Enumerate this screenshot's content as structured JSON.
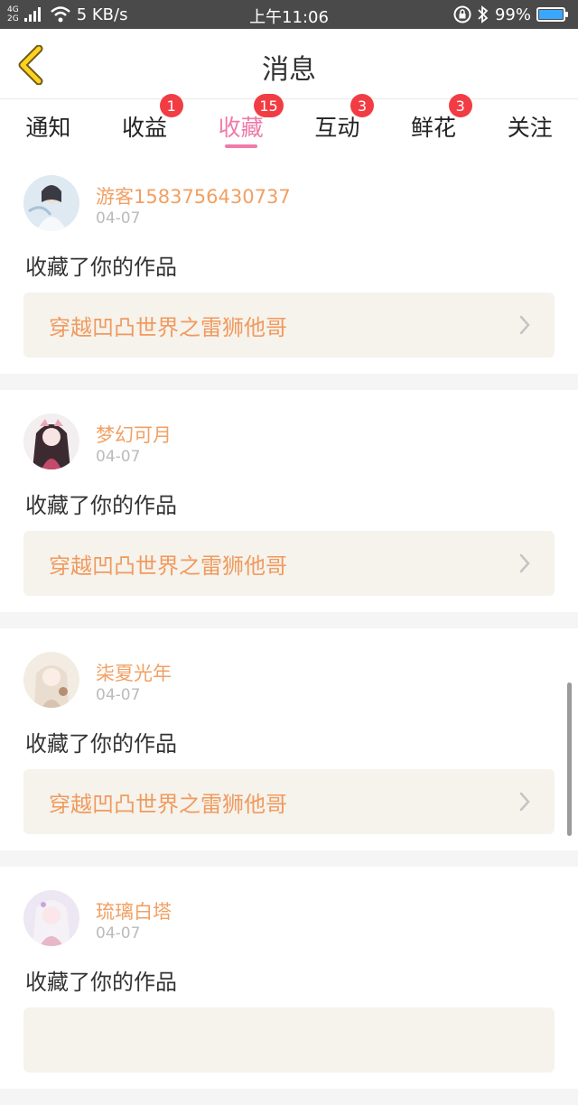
{
  "status": {
    "network": "4G\n2G",
    "speed": "5 KB/s",
    "time": "上午11:06",
    "battery": "99%"
  },
  "header": {
    "title": "消息"
  },
  "tabs": [
    {
      "label": "通知",
      "badge": ""
    },
    {
      "label": "收益",
      "badge": "1"
    },
    {
      "label": "收藏",
      "badge": "15"
    },
    {
      "label": "互动",
      "badge": "3"
    },
    {
      "label": "鲜花",
      "badge": "3"
    },
    {
      "label": "关注",
      "badge": ""
    }
  ],
  "messages": [
    {
      "user": "游客1583756430737",
      "date": "04-07",
      "action": "收藏了你的作品",
      "work": "穿越凹凸世界之雷狮他哥"
    },
    {
      "user": "梦幻可月",
      "date": "04-07",
      "action": "收藏了你的作品",
      "work": "穿越凹凸世界之雷狮他哥"
    },
    {
      "user": "柒夏光年",
      "date": "04-07",
      "action": "收藏了你的作品",
      "work": "穿越凹凸世界之雷狮他哥"
    },
    {
      "user": "琉璃白塔",
      "date": "04-07",
      "action": "收藏了你的作品",
      "work": ""
    }
  ],
  "colors": {
    "accent": "#f07aa8",
    "badge": "#f23c44",
    "username": "#f1a063",
    "work_title": "#f19a5f"
  }
}
